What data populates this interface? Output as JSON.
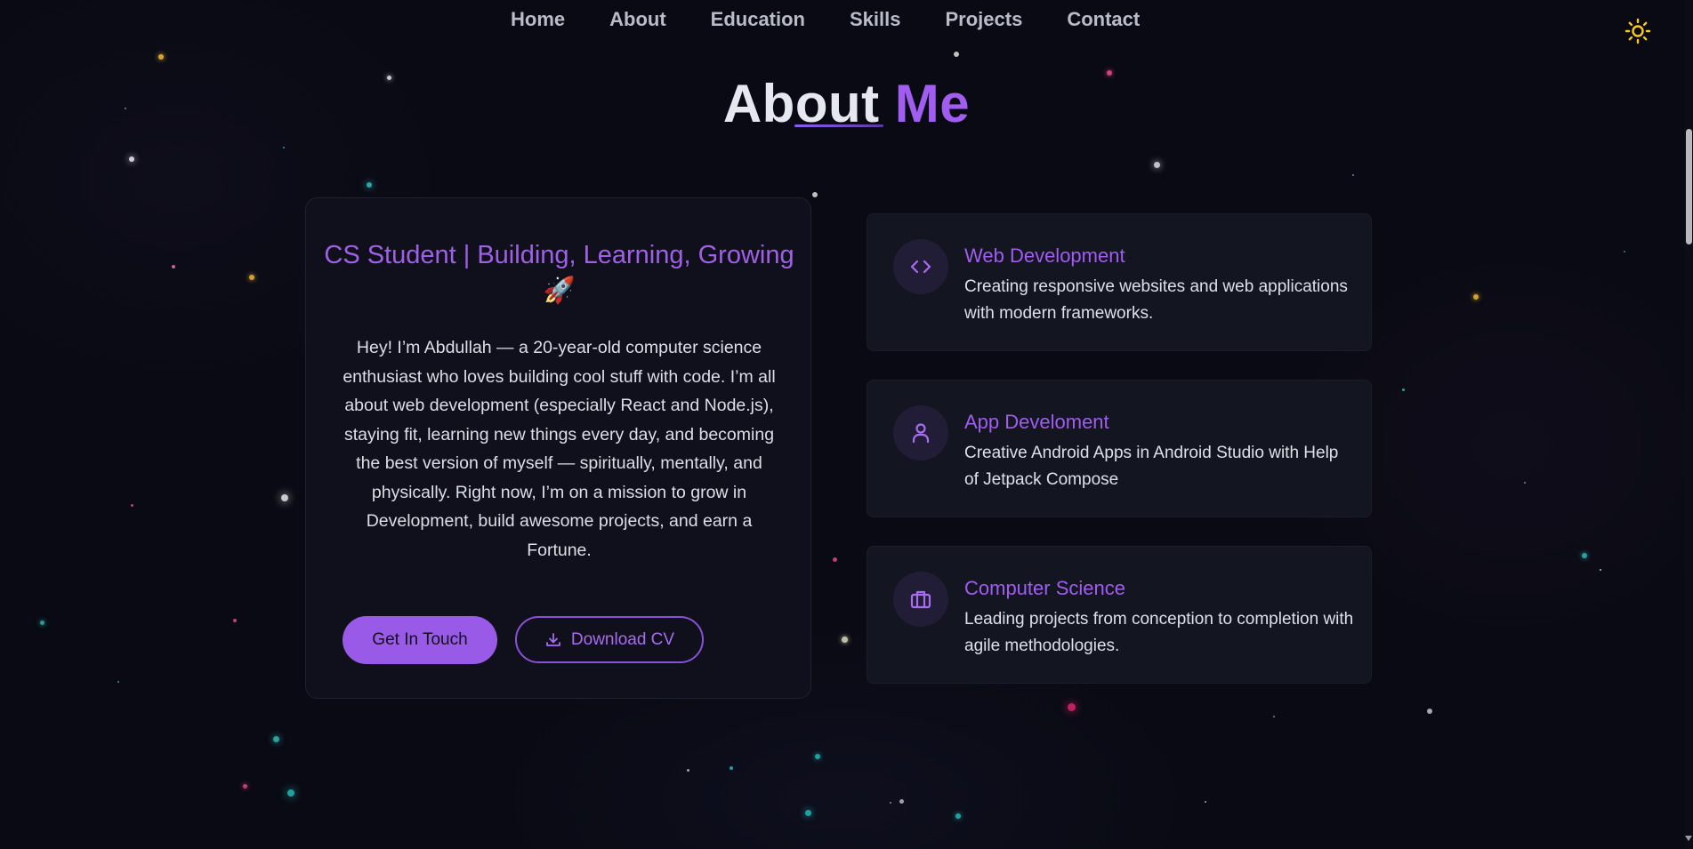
{
  "nav": {
    "links": [
      "Home",
      "About",
      "Education",
      "Skills",
      "Projects",
      "Contact"
    ],
    "theme_icon": "sun-icon"
  },
  "section": {
    "title_part1": "About",
    "title_part2": "Me"
  },
  "intro": {
    "heading": "CS Student | Building, Learning, Growing 🚀",
    "text": "Hey! I’m Abdullah — a 20-year-old computer science enthusiast who loves building cool stuff with code. I’m all about web development (especially React and Node.js), staying fit, learning new things every day, and becoming the best version of myself — spiritually, mentally, and physically. Right now, I’m on a mission to grow in Development, build awesome projects, and earn a Fortune.",
    "primary_button": "Get In Touch",
    "secondary_button": "Download CV",
    "secondary_icon": "download-icon"
  },
  "services": [
    {
      "title": "Web Development",
      "description": "Creating responsive websites and web applications with modern frameworks.",
      "icon": "code-icon"
    },
    {
      "title": "App Develoment",
      "description": "Creative Android Apps in Android Studio with Help of Jetpack Compose",
      "icon": "user-icon"
    },
    {
      "title": "Computer Science",
      "description": "Leading projects from conception to completion with agile methodologies.",
      "icon": "briefcase-icon"
    }
  ],
  "colors": {
    "accent": "#a15cf0",
    "background": "#090a13",
    "card": "#131520",
    "sun": "#facc15"
  }
}
